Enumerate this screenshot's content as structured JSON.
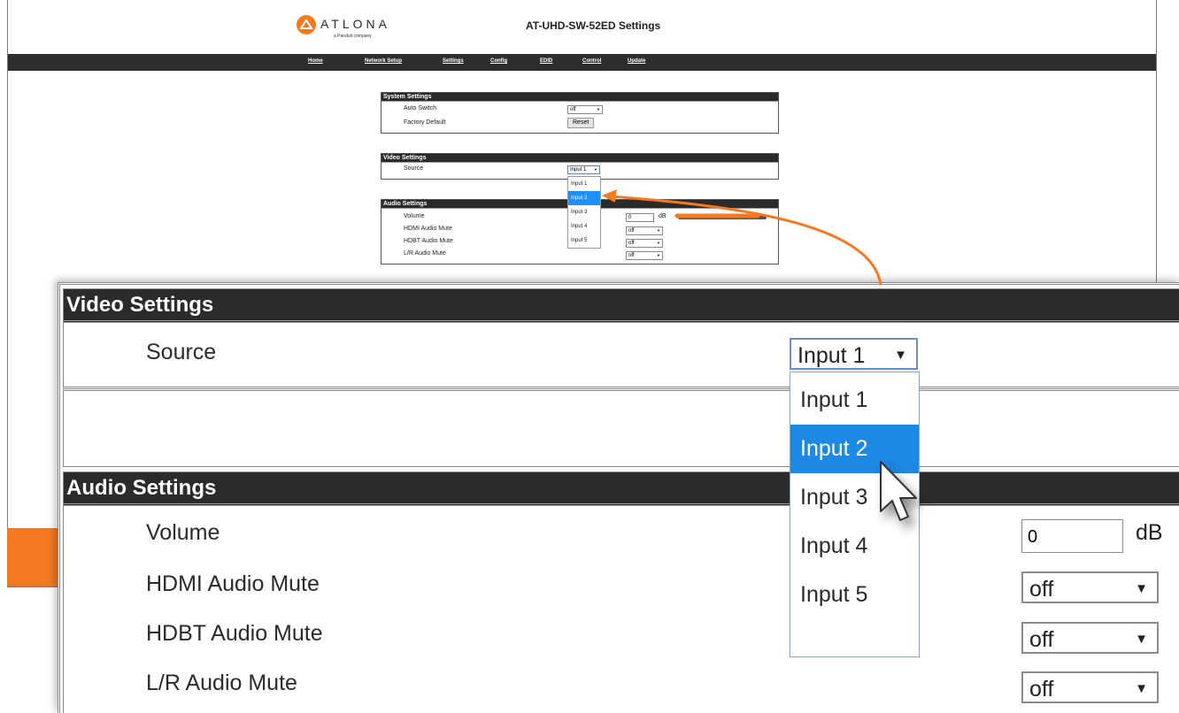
{
  "header": {
    "brand": "ATLONA",
    "brand_sub": "a Panduit company",
    "title": "AT-UHD-SW-52ED Settings"
  },
  "nav": [
    "Home",
    "Network Setup",
    "Settings",
    "Config",
    "EDID",
    "Control",
    "Update"
  ],
  "system_settings": {
    "title": "System Settings",
    "auto_switch_label": "Auto Switch",
    "auto_switch_value": "off",
    "factory_default_label": "Factory Default",
    "reset_label": "Reset"
  },
  "video_settings": {
    "title": "Video Settings",
    "source_label": "Source",
    "source_value": "Input 1",
    "options": [
      "Input 1",
      "Input 2",
      "Input 3",
      "Input 4",
      "Input 5"
    ],
    "highlighted": "Input 2"
  },
  "audio_settings": {
    "title": "Audio Settings",
    "volume_label": "Volume",
    "volume_value": "0",
    "volume_unit": "dB",
    "hdmi_mute_label": "HDMI Audio Mute",
    "hdmi_mute_value": "off",
    "hdbt_mute_label": "HDBT Audio Mute",
    "hdbt_mute_value": "off",
    "lr_mute_label": "L/R Audio Mute",
    "lr_mute_value": "off"
  },
  "colors": {
    "accent": "#f47920",
    "header_bar": "#2b2b2b",
    "selection": "#1e88e5"
  }
}
